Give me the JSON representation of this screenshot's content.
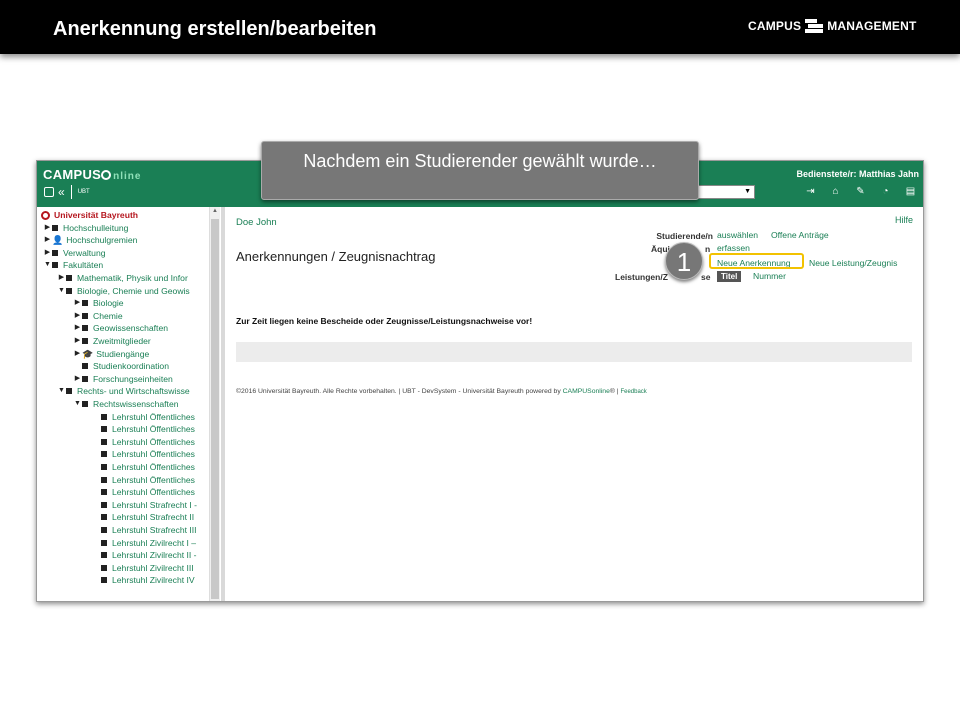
{
  "slide": {
    "title": "Anerkennung erstellen/bearbeiten",
    "logo_left": "CAMPUS",
    "logo_right": "MANAGEMENT"
  },
  "callout": {
    "text": "Nachdem ein Studierender gewählt wurde…",
    "step_number": "1"
  },
  "app": {
    "logo_main": "CAMPUS",
    "logo_online": "nline",
    "logo_unit": "UBT",
    "user_label": "Bedienstete/r: Matthias Jahn",
    "select_value": "▼",
    "header_icons": [
      {
        "icon": "logout-icon",
        "glyph": "⇥"
      },
      {
        "icon": "home-icon",
        "glyph": "⌂"
      },
      {
        "icon": "edit-icon",
        "glyph": "✎"
      },
      {
        "icon": "dashboard-icon",
        "glyph": "◔"
      },
      {
        "icon": "book-icon",
        "glyph": "▤"
      }
    ],
    "accent_color": "#1a7f55",
    "highlight_color": "#f2c200"
  },
  "tree": {
    "items": [
      {
        "label": "Universität Bayreuth",
        "type": "root",
        "level": 0
      },
      {
        "label": "Hochschulleitung",
        "arrow": "▶",
        "level": 0
      },
      {
        "label": "Hochschulgremien",
        "arrow": "▶",
        "level": 0,
        "icon": "person"
      },
      {
        "label": "Verwaltung",
        "arrow": "▶",
        "level": 0
      },
      {
        "label": "Fakultäten",
        "arrow": "▼",
        "level": 0
      },
      {
        "label": "Mathematik, Physik und Infor",
        "arrow": "▶",
        "level": 1
      },
      {
        "label": "Biologie, Chemie und Geowis",
        "arrow": "▼",
        "level": 1
      },
      {
        "label": "Biologie",
        "arrow": "▶",
        "level": 2
      },
      {
        "label": "Chemie",
        "arrow": "▶",
        "level": 2
      },
      {
        "label": "Geowissenschaften",
        "arrow": "▶",
        "level": 2
      },
      {
        "label": "Zweitmitglieder",
        "arrow": "▶",
        "level": 2
      },
      {
        "label": "Studiengänge",
        "arrow": "▶",
        "level": 2,
        "icon": "hat"
      },
      {
        "label": "Studienkoordination",
        "arrow": "",
        "level": 2
      },
      {
        "label": "Forschungseinheiten",
        "arrow": "▶",
        "level": 2
      },
      {
        "label": "Rechts- und Wirtschaftswisse",
        "arrow": "▼",
        "level": 1
      },
      {
        "label": "Rechtswissenschaften",
        "arrow": "▼",
        "level": 2
      },
      {
        "label": "Lehrstuhl Öffentliches",
        "arrow": "",
        "level": 3
      },
      {
        "label": "Lehrstuhl Öffentliches",
        "arrow": "",
        "level": 3
      },
      {
        "label": "Lehrstuhl Öffentliches",
        "arrow": "",
        "level": 3
      },
      {
        "label": "Lehrstuhl Öffentliches",
        "arrow": "",
        "level": 3
      },
      {
        "label": "Lehrstuhl Öffentliches",
        "arrow": "",
        "level": 3
      },
      {
        "label": "Lehrstuhl Öffentliches",
        "arrow": "",
        "level": 3
      },
      {
        "label": "Lehrstuhl Öffentliches",
        "arrow": "",
        "level": 3
      },
      {
        "label": "Lehrstuhl Strafrecht I -",
        "arrow": "",
        "level": 3
      },
      {
        "label": "Lehrstuhl Strafrecht II",
        "arrow": "",
        "level": 3
      },
      {
        "label": "Lehrstuhl Strafrecht III",
        "arrow": "",
        "level": 3
      },
      {
        "label": "Lehrstuhl Zivilrecht I –",
        "arrow": "",
        "level": 3
      },
      {
        "label": "Lehrstuhl Zivilrecht II -",
        "arrow": "",
        "level": 3
      },
      {
        "label": "Lehrstuhl Zivilrecht III",
        "arrow": "",
        "level": 3
      },
      {
        "label": "Lehrstuhl Zivilrecht IV",
        "arrow": "",
        "level": 3
      }
    ]
  },
  "content": {
    "student_name": "Doe John",
    "help_link": "Hilfe",
    "heading": "Anerkennungen / Zeugnisnachtrag",
    "label_student": "Studierende/n",
    "link_select": "auswählen",
    "link_open_requests": "Offene Anträge",
    "label_equivalence": "Äqui",
    "label_equivalence_tail": "n",
    "link_capture": "erfassen",
    "link_new_recognition": "Neue Anerkennung",
    "link_new_performance": "Neue Leistung/Zeugnis",
    "label_performances": "Leistungen/Z",
    "label_performances_tail": "se",
    "sort_title": "Titel",
    "sort_number": "Nummer",
    "empty_message": "Zur Zeit liegen keine Bescheide oder Zeugnisse/Leistungsnachweise vor!",
    "footer_text": "©2016 Universität Bayreuth. Alle Rechte vorbehalten. | UBT - DevSystem - Universität Bayreuth powered by ",
    "footer_link": "CAMPUSonline",
    "footer_tail": "® | ",
    "footer_feedback": "Feedback"
  }
}
